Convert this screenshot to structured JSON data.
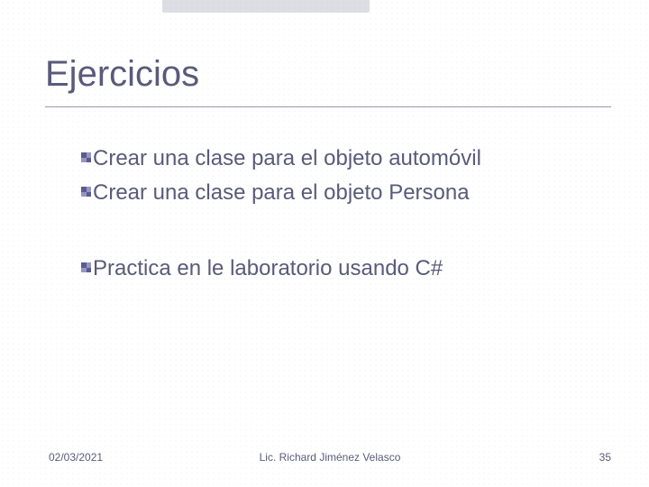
{
  "title": "Ejercicios",
  "bullets": [
    "Crear una clase para el objeto automóvil",
    "Crear una clase para el objeto Persona",
    "Practica en le laboratorio usando C#"
  ],
  "footer": {
    "date": "02/03/2021",
    "author": "Lic. Richard Jiménez Velasco",
    "page": "35"
  }
}
